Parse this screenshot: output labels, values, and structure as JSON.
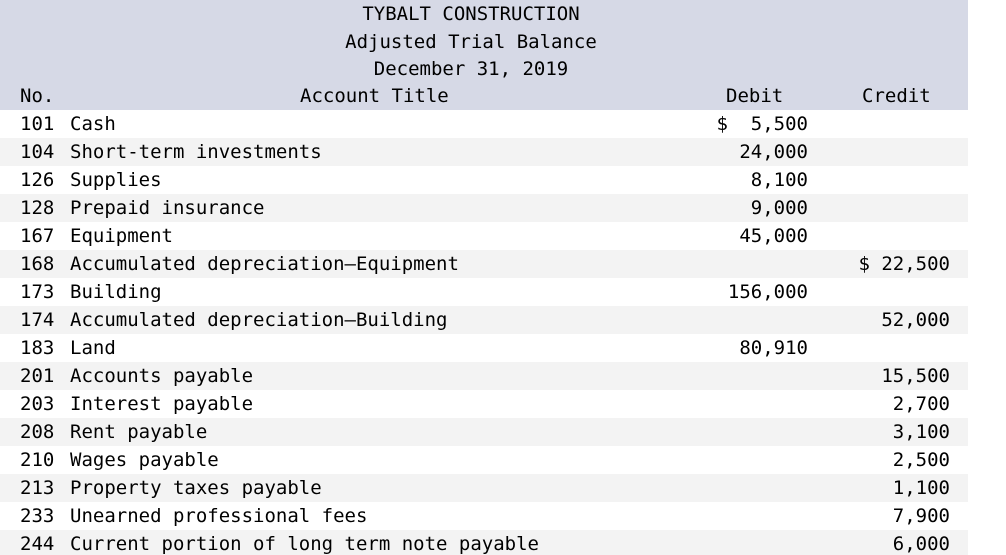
{
  "header": {
    "company": "TYBALT CONSTRUCTION",
    "report": "Adjusted Trial Balance",
    "date": "December 31, 2019",
    "col_no": "No.",
    "col_title": "Account Title",
    "col_debit": "Debit",
    "col_credit": "Credit"
  },
  "rows": [
    {
      "no": "101",
      "title": "Cash",
      "debit": "$  5,500",
      "credit": ""
    },
    {
      "no": "104",
      "title": "Short-term investments",
      "debit": "24,000",
      "credit": ""
    },
    {
      "no": "126",
      "title": "Supplies",
      "debit": "8,100",
      "credit": ""
    },
    {
      "no": "128",
      "title": "Prepaid insurance",
      "debit": "9,000",
      "credit": ""
    },
    {
      "no": "167",
      "title": "Equipment",
      "debit": "45,000",
      "credit": ""
    },
    {
      "no": "168",
      "title": "Accumulated depreciation—Equipment",
      "debit": "",
      "credit": "$ 22,500"
    },
    {
      "no": "173",
      "title": "Building",
      "debit": "156,000",
      "credit": ""
    },
    {
      "no": "174",
      "title": "Accumulated depreciation—Building",
      "debit": "",
      "credit": "52,000"
    },
    {
      "no": "183",
      "title": "Land",
      "debit": "80,910",
      "credit": ""
    },
    {
      "no": "201",
      "title": "Accounts payable",
      "debit": "",
      "credit": "15,500"
    },
    {
      "no": "203",
      "title": "Interest payable",
      "debit": "",
      "credit": "2,700"
    },
    {
      "no": "208",
      "title": "Rent payable",
      "debit": "",
      "credit": "3,100"
    },
    {
      "no": "210",
      "title": "Wages payable",
      "debit": "",
      "credit": "2,500"
    },
    {
      "no": "213",
      "title": "Property taxes payable",
      "debit": "",
      "credit": "1,100"
    },
    {
      "no": "233",
      "title": "Unearned professional fees",
      "debit": "",
      "credit": "7,900"
    },
    {
      "no": "244",
      "title": "Current portion of long term note payable",
      "debit": "",
      "credit": "6,000"
    }
  ]
}
